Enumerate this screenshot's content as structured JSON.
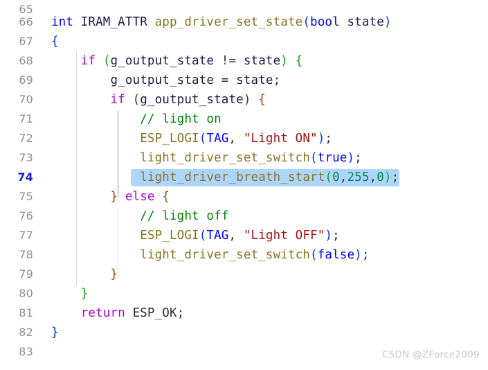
{
  "editor": {
    "language": "c",
    "theme": "light-plus",
    "first_line_number": 65,
    "active_line_number": 74,
    "colors": {
      "background": "#ffffff",
      "gutter_text": "#8a8f98",
      "active_gutter_text": "#1a1ad6",
      "selection_highlight": "#add6ff",
      "keyword": "#0000ff",
      "control_keyword": "#af00db",
      "function": "#8a7322",
      "identifier": "#1b1b4a",
      "string": "#a31515",
      "comment": "#008000",
      "number": "#098658",
      "bracket_level_1": "#179e18",
      "bracket_level_2": "#9a4c00",
      "bracket_level_3": "#0431fa",
      "indent_guide": "#d8d8d8",
      "indent_guide_active": "#949494",
      "watermark": "#c9c9c9"
    }
  },
  "lines": [
    {
      "number": "65",
      "text": ""
    },
    {
      "number": "66",
      "text": "int IRAM_ATTR app_driver_set_state(bool state)"
    },
    {
      "number": "67",
      "text": "{"
    },
    {
      "number": "68",
      "text": "    if (g_output_state != state) {"
    },
    {
      "number": "69",
      "text": "        g_output_state = state;"
    },
    {
      "number": "70",
      "text": "        if (g_output_state) {"
    },
    {
      "number": "71",
      "text": "            // light on"
    },
    {
      "number": "72",
      "text": "            ESP_LOGI(TAG, \"Light ON\");"
    },
    {
      "number": "73",
      "text": "            light_driver_set_switch(true);"
    },
    {
      "number": "74",
      "text": "            light_driver_breath_start(0,255,0);"
    },
    {
      "number": "75",
      "text": "        } else {"
    },
    {
      "number": "76",
      "text": "            // light off"
    },
    {
      "number": "77",
      "text": "            ESP_LOGI(TAG, \"Light OFF\");"
    },
    {
      "number": "78",
      "text": "            light_driver_set_switch(false);"
    },
    {
      "number": "79",
      "text": "        }"
    },
    {
      "number": "80",
      "text": "    }"
    },
    {
      "number": "81",
      "text": "    return ESP_OK;"
    },
    {
      "number": "82",
      "text": "}"
    },
    {
      "number": "83",
      "text": ""
    }
  ],
  "tokens": {
    "l66": {
      "int": "int",
      "sp1": " ",
      "iram_attr": "IRAM_ATTR",
      "sp2": " ",
      "fname": "app_driver_set_state",
      "lparen": "(",
      "bool": "bool",
      "sp3": " ",
      "param": "state",
      "rparen": ")"
    },
    "l67": {
      "brace": "{"
    },
    "l68": {
      "indent": "    ",
      "if": "if",
      "sp": " ",
      "lparen": "(",
      "var": "g_output_state",
      "op": " != ",
      "state": "state",
      "rparen": ")",
      "sp2": " ",
      "brace": "{"
    },
    "l69": {
      "indent": "        ",
      "var": "g_output_state",
      "op": " = ",
      "state": "state",
      "semi": ";"
    },
    "l70": {
      "indent": "        ",
      "if": "if",
      "sp": " ",
      "lparen": "(",
      "var": "g_output_state",
      "rparen": ")",
      "sp2": " ",
      "brace": "{"
    },
    "l71": {
      "indent": "            ",
      "comment": "// light on"
    },
    "l72": {
      "indent": "            ",
      "fname": "ESP_LOGI",
      "lparen": "(",
      "tag": "TAG",
      "comma": ", ",
      "str": "\"Light ON\"",
      "rparen": ")",
      "semi": ";"
    },
    "l73": {
      "indent": "            ",
      "fname": "light_driver_set_switch",
      "lparen": "(",
      "bool": "true",
      "rparen": ")",
      "semi": ";"
    },
    "l74": {
      "indent": "           ",
      "dot": "·",
      "fname": "light_driver_breath_start",
      "lparen": "(",
      "n1": "0",
      "c1": ",",
      "n2": "255",
      "c2": ",",
      "n3": "0",
      "rparen": ")",
      "semi": ";"
    },
    "l75": {
      "indent": "        ",
      "rbrace": "}",
      "sp": " ",
      "else": "else",
      "sp2": " ",
      "lbrace": "{"
    },
    "l76": {
      "indent": "            ",
      "comment": "// light off"
    },
    "l77": {
      "indent": "            ",
      "fname": "ESP_LOGI",
      "lparen": "(",
      "tag": "TAG",
      "comma": ", ",
      "str": "\"Light OFF\"",
      "rparen": ")",
      "semi": ";"
    },
    "l78": {
      "indent": "            ",
      "fname": "light_driver_set_switch",
      "lparen": "(",
      "bool": "false",
      "rparen": ")",
      "semi": ";"
    },
    "l79": {
      "indent": "        ",
      "brace": "}"
    },
    "l80": {
      "indent": "    ",
      "brace": "}"
    },
    "l81": {
      "indent": "    ",
      "return": "return",
      "sp": " ",
      "value": "ESP_OK",
      "semi": ";"
    },
    "l82": {
      "brace": "}"
    }
  },
  "watermark": {
    "text": "CSDN @ZForce2009"
  }
}
